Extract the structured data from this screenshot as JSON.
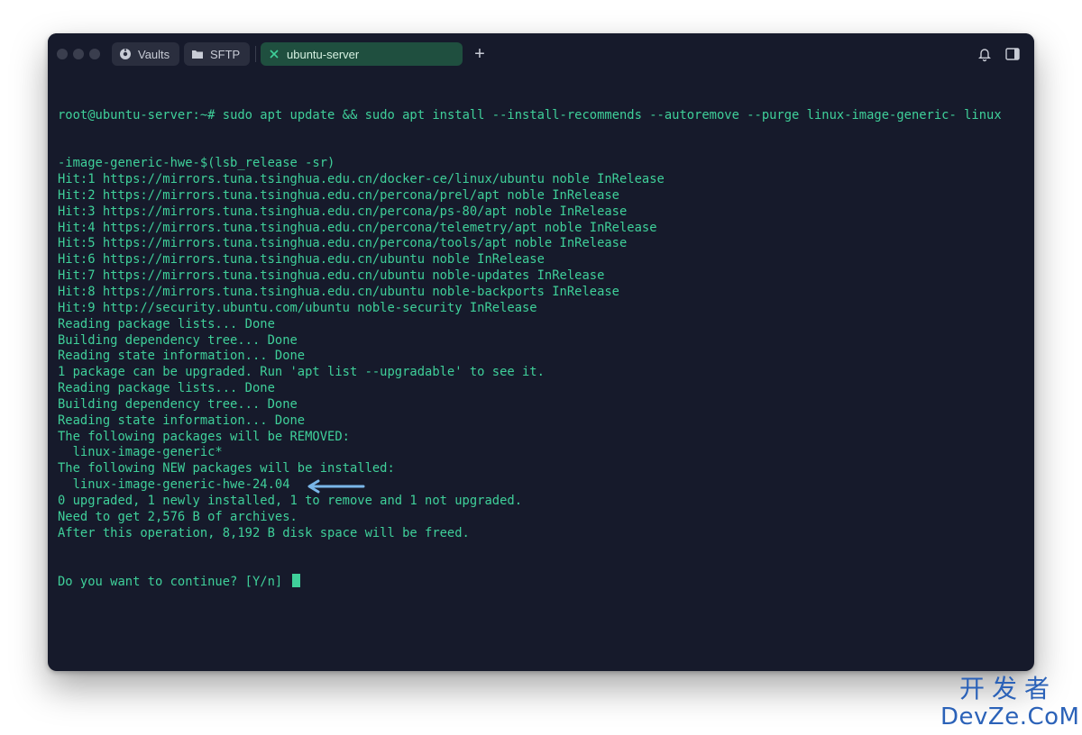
{
  "tabs": [
    {
      "label": "Vaults",
      "icon": "vault-icon"
    },
    {
      "label": "SFTP",
      "icon": "folder-icon"
    },
    {
      "label": "ubuntu-server",
      "icon": "close-icon",
      "active": true
    }
  ],
  "colors": {
    "window_bg": "#161a2b",
    "terminal_text": "#3fd09a",
    "active_tab": "#1f4f3f",
    "arrow": "#7ab6e8",
    "watermark": "#2b62b8"
  },
  "terminal": {
    "prompt_user": "root@ubuntu-server",
    "prompt_rest": ":~# sudo apt update && sudo apt install --install-recommends --autoremove --purge linux-image-generic- linux",
    "lines": [
      "-image-generic-hwe-$(lsb_release -sr)",
      "Hit:1 https://mirrors.tuna.tsinghua.edu.cn/docker-ce/linux/ubuntu noble InRelease",
      "Hit:2 https://mirrors.tuna.tsinghua.edu.cn/percona/prel/apt noble InRelease",
      "Hit:3 https://mirrors.tuna.tsinghua.edu.cn/percona/ps-80/apt noble InRelease",
      "Hit:4 https://mirrors.tuna.tsinghua.edu.cn/percona/telemetry/apt noble InRelease",
      "Hit:5 https://mirrors.tuna.tsinghua.edu.cn/percona/tools/apt noble InRelease",
      "Hit:6 https://mirrors.tuna.tsinghua.edu.cn/ubuntu noble InRelease",
      "Hit:7 https://mirrors.tuna.tsinghua.edu.cn/ubuntu noble-updates InRelease",
      "Hit:8 https://mirrors.tuna.tsinghua.edu.cn/ubuntu noble-backports InRelease",
      "Hit:9 http://security.ubuntu.com/ubuntu noble-security InRelease",
      "Reading package lists... Done",
      "Building dependency tree... Done",
      "Reading state information... Done",
      "1 package can be upgraded. Run 'apt list --upgradable' to see it.",
      "Reading package lists... Done",
      "Building dependency tree... Done",
      "Reading state information... Done",
      "The following packages will be REMOVED:",
      "  linux-image-generic*",
      "The following NEW packages will be installed:",
      "  linux-image-generic-hwe-24.04",
      "0 upgraded, 1 newly installed, 1 to remove and 1 not upgraded.",
      "Need to get 2,576 B of archives.",
      "After this operation, 8,192 B disk space will be freed."
    ],
    "final_prompt": "Do you want to continue? [Y/n] "
  },
  "watermark": {
    "line1": "开发者",
    "line2": "DevZe.CoM"
  }
}
